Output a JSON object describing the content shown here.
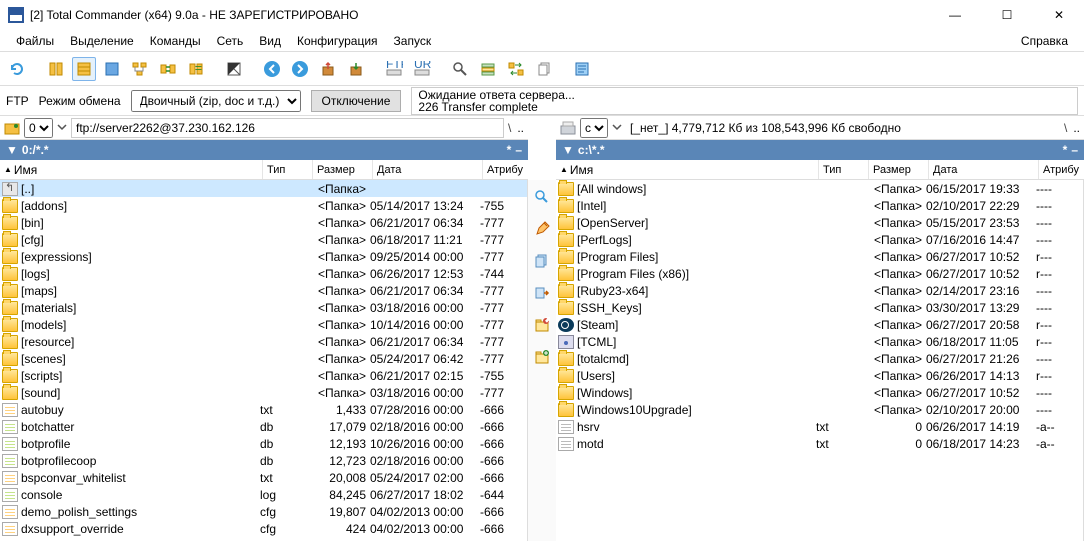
{
  "window": {
    "title": "[2] Total Commander (x64) 9.0a - НЕ ЗАРЕГИСТРИРОВАНО"
  },
  "menu": {
    "file": "Файлы",
    "selection": "Выделение",
    "commands": "Команды",
    "net": "Сеть",
    "view": "Вид",
    "config": "Конфигурация",
    "start": "Запуск",
    "help": "Справка"
  },
  "ftpbar": {
    "label": "FTP",
    "mode_label": "Режим обмена",
    "mode_value": "Двоичный (zip, doc и т.д.)",
    "disconnect": "Отключение",
    "status_line1": "Ожидание ответа сервера...",
    "status_line2": "226 Transfer complete"
  },
  "driverow": {
    "left_drive": "0",
    "left_addr": "ftp://server2262@37.230.162.126",
    "right_drive": "c",
    "right_free": "[_нет_]  4,779,712 Кб из 108,543,996 Кб свободно",
    "slash": "\\",
    "dots": ".."
  },
  "paths": {
    "left": "0:/*.*",
    "right": "c:\\*.*",
    "star": "*",
    "dash": "–"
  },
  "cols": {
    "name": "Имя",
    "type": "Тип",
    "size": "Размер",
    "date": "Дата",
    "attr": "Атрибу",
    "name_arrow": "▲"
  },
  "left": [
    {
      "icon": "upfolder",
      "name": "[..]",
      "type": "",
      "size": "<Папка>",
      "date": "",
      "attr": "",
      "sel": true
    },
    {
      "icon": "folder",
      "name": "[addons]",
      "type": "",
      "size": "<Папка>",
      "date": "05/14/2017 13:24",
      "attr": "-755"
    },
    {
      "icon": "folder",
      "name": "[bin]",
      "type": "",
      "size": "<Папка>",
      "date": "06/21/2017 06:34",
      "attr": "-777"
    },
    {
      "icon": "folder",
      "name": "[cfg]",
      "type": "",
      "size": "<Папка>",
      "date": "06/18/2017 11:21",
      "attr": "-777"
    },
    {
      "icon": "folder",
      "name": "[expressions]",
      "type": "",
      "size": "<Папка>",
      "date": "09/25/2014 00:00",
      "attr": "-777"
    },
    {
      "icon": "folder",
      "name": "[logs]",
      "type": "",
      "size": "<Папка>",
      "date": "06/26/2017 12:53",
      "attr": "-744"
    },
    {
      "icon": "folder",
      "name": "[maps]",
      "type": "",
      "size": "<Папка>",
      "date": "06/21/2017 06:34",
      "attr": "-777"
    },
    {
      "icon": "folder",
      "name": "[materials]",
      "type": "",
      "size": "<Папка>",
      "date": "03/18/2016 00:00",
      "attr": "-777"
    },
    {
      "icon": "folder",
      "name": "[models]",
      "type": "",
      "size": "<Папка>",
      "date": "10/14/2016 00:00",
      "attr": "-777"
    },
    {
      "icon": "folder",
      "name": "[resource]",
      "type": "",
      "size": "<Папка>",
      "date": "06/21/2017 06:34",
      "attr": "-777"
    },
    {
      "icon": "folder",
      "name": "[scenes]",
      "type": "",
      "size": "<Папка>",
      "date": "05/24/2017 06:42",
      "attr": "-777"
    },
    {
      "icon": "folder",
      "name": "[scripts]",
      "type": "",
      "size": "<Папка>",
      "date": "06/21/2017 02:15",
      "attr": "-755"
    },
    {
      "icon": "folder",
      "name": "[sound]",
      "type": "",
      "size": "<Папка>",
      "date": "03/18/2016 00:00",
      "attr": "-777"
    },
    {
      "icon": "file cfg",
      "name": "autobuy",
      "type": "txt",
      "size": "1,433",
      "date": "07/28/2016 00:00",
      "attr": "-666"
    },
    {
      "icon": "file",
      "name": "botchatter",
      "type": "db",
      "size": "17,079",
      "date": "02/18/2016 00:00",
      "attr": "-666"
    },
    {
      "icon": "file",
      "name": "botprofile",
      "type": "db",
      "size": "12,193",
      "date": "10/26/2016 00:00",
      "attr": "-666"
    },
    {
      "icon": "file",
      "name": "botprofilecoop",
      "type": "db",
      "size": "12,723",
      "date": "02/18/2016 00:00",
      "attr": "-666"
    },
    {
      "icon": "file cfg",
      "name": "bspconvar_whitelist",
      "type": "txt",
      "size": "20,008",
      "date": "05/24/2017 02:00",
      "attr": "-666"
    },
    {
      "icon": "file",
      "name": "console",
      "type": "log",
      "size": "84,245",
      "date": "06/27/2017 18:02",
      "attr": "-644"
    },
    {
      "icon": "file cfg",
      "name": "demo_polish_settings",
      "type": "cfg",
      "size": "19,807",
      "date": "04/02/2013 00:00",
      "attr": "-666"
    },
    {
      "icon": "file cfg",
      "name": "dxsupport_override",
      "type": "cfg",
      "size": "424",
      "date": "04/02/2013 00:00",
      "attr": "-666"
    }
  ],
  "right": [
    {
      "icon": "folder",
      "name": "[All windows]",
      "type": "",
      "size": "<Папка>",
      "date": "06/15/2017 19:33",
      "attr": "----"
    },
    {
      "icon": "folder",
      "name": "[Intel]",
      "type": "",
      "size": "<Папка>",
      "date": "02/10/2017 22:29",
      "attr": "----"
    },
    {
      "icon": "folder",
      "name": "[OpenServer]",
      "type": "",
      "size": "<Папка>",
      "date": "05/15/2017 23:53",
      "attr": "----"
    },
    {
      "icon": "folder",
      "name": "[PerfLogs]",
      "type": "",
      "size": "<Папка>",
      "date": "07/16/2016 14:47",
      "attr": "----"
    },
    {
      "icon": "folder",
      "name": "[Program Files]",
      "type": "",
      "size": "<Папка>",
      "date": "06/27/2017 10:52",
      "attr": "r---"
    },
    {
      "icon": "folder",
      "name": "[Program Files (x86)]",
      "type": "",
      "size": "<Папка>",
      "date": "06/27/2017 10:52",
      "attr": "r---"
    },
    {
      "icon": "folder",
      "name": "[Ruby23-x64]",
      "type": "",
      "size": "<Папка>",
      "date": "02/14/2017 23:16",
      "attr": "----"
    },
    {
      "icon": "folder",
      "name": "[SSH_Keys]",
      "type": "",
      "size": "<Папка>",
      "date": "03/30/2017 13:29",
      "attr": "----"
    },
    {
      "icon": "steam",
      "name": "[Steam]",
      "type": "",
      "size": "<Папка>",
      "date": "06/27/2017 20:58",
      "attr": "r---"
    },
    {
      "icon": "disk",
      "name": "[TCML]",
      "type": "",
      "size": "<Папка>",
      "date": "06/18/2017 11:05",
      "attr": "r---"
    },
    {
      "icon": "folder",
      "name": "[totalcmd]",
      "type": "",
      "size": "<Папка>",
      "date": "06/27/2017 21:26",
      "attr": "----"
    },
    {
      "icon": "folder",
      "name": "[Users]",
      "type": "",
      "size": "<Папка>",
      "date": "06/26/2017 14:13",
      "attr": "r---"
    },
    {
      "icon": "folder",
      "name": "[Windows]",
      "type": "",
      "size": "<Папка>",
      "date": "06/27/2017 10:52",
      "attr": "----"
    },
    {
      "icon": "folder",
      "name": "[Windows10Upgrade]",
      "type": "",
      "size": "<Папка>",
      "date": "02/10/2017 20:00",
      "attr": "----"
    },
    {
      "icon": "txt",
      "name": "hsrv",
      "type": "txt",
      "size": "0",
      "date": "06/26/2017 14:19",
      "attr": "-a--"
    },
    {
      "icon": "txt",
      "name": "motd",
      "type": "txt",
      "size": "0",
      "date": "06/18/2017 14:23",
      "attr": "-a--"
    }
  ]
}
